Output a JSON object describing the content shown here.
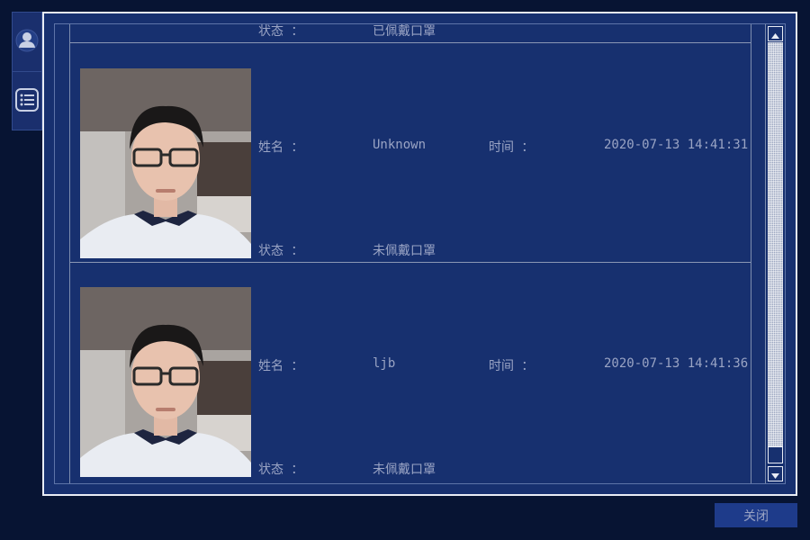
{
  "side_tabs": [
    {
      "icon": "user-icon"
    },
    {
      "icon": "list-icon"
    }
  ],
  "records": [
    {
      "status_label": "状态 ：",
      "status_value": "已佩戴口罩",
      "photo": "face-photo"
    },
    {
      "name_label": "姓名 ：",
      "name_value": "Unknown",
      "time_label": "时间 ：",
      "time_value": "2020-07-13 14:41:31",
      "status_label": "状态 ：",
      "status_value": "未佩戴口罩",
      "photo": "face-photo"
    },
    {
      "name_label": "姓名 ：",
      "name_value": "ljb",
      "time_label": "时间 ：",
      "time_value": "2020-07-13 14:41:36",
      "status_label": "状态 ：",
      "status_value": "未佩戴口罩",
      "photo": "face-photo"
    }
  ],
  "scrollbar": {
    "up_icon": "arrow-up-icon",
    "down_icon": "arrow-down-icon"
  },
  "footer": {
    "close_label": "关闭"
  },
  "colors": {
    "background": "#071433",
    "panel": "#17306f",
    "text": "#9aa4c4",
    "border": "#e8ecf5"
  }
}
